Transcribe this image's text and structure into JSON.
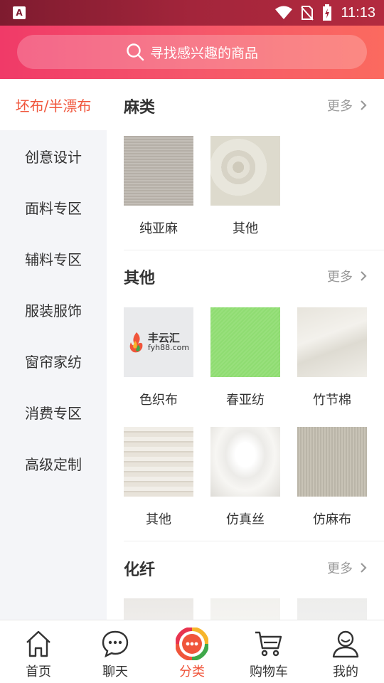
{
  "status_bar": {
    "time": "11:13",
    "app_badge": "A"
  },
  "search": {
    "placeholder": "寻找感兴趣的商品"
  },
  "sidebar": {
    "items": [
      {
        "label": "坯布/半漂布",
        "active": true
      },
      {
        "label": "创意设计"
      },
      {
        "label": "面料专区"
      },
      {
        "label": "辅料专区"
      },
      {
        "label": "服装服饰"
      },
      {
        "label": "窗帘家纺"
      },
      {
        "label": "消费专区"
      },
      {
        "label": "高级定制"
      }
    ]
  },
  "sections": [
    {
      "title": "麻类",
      "more": "更多",
      "items": [
        {
          "label": "纯亚麻"
        },
        {
          "label": "其他"
        }
      ]
    },
    {
      "title": "其他",
      "more": "更多",
      "items": [
        {
          "label": "色织布"
        },
        {
          "label": "春亚纺"
        },
        {
          "label": "竹节棉"
        },
        {
          "label": "其他"
        },
        {
          "label": "仿真丝"
        },
        {
          "label": "仿麻布"
        }
      ]
    },
    {
      "title": "化纤",
      "more": "更多",
      "items": []
    }
  ],
  "logo": {
    "brand": "丰云汇",
    "domain": "fyh88.com"
  },
  "tabbar": {
    "items": [
      {
        "label": "首页",
        "icon": "home-icon"
      },
      {
        "label": "聊天",
        "icon": "chat-icon"
      },
      {
        "label": "分类",
        "icon": "category-icon",
        "active": true
      },
      {
        "label": "购物车",
        "icon": "cart-icon"
      },
      {
        "label": "我的",
        "icon": "profile-icon"
      }
    ]
  },
  "colors": {
    "accent": "#f0553b",
    "header_start": "#f03a68",
    "header_end": "#fb6a5f"
  }
}
